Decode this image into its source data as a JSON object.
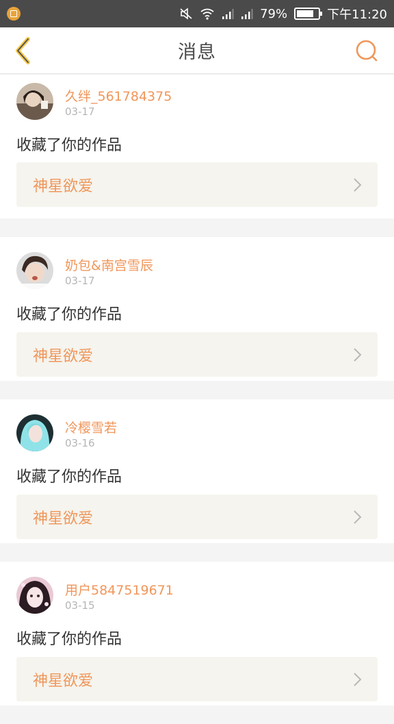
{
  "status_bar": {
    "battery": "79%",
    "time": "下午11:20",
    "battery_level": 0.79
  },
  "header": {
    "title": "消息",
    "accent_color": "#f0965a"
  },
  "messages": [
    {
      "user": "久绊_561784375",
      "date": "03-17",
      "action": "收藏了你的作品",
      "work": "神星欲爱"
    },
    {
      "user": "奶包&南宫雪辰",
      "date": "03-17",
      "action": "收藏了你的作品",
      "work": "神星欲爱"
    },
    {
      "user": "冷樱雪若",
      "date": "03-16",
      "action": "收藏了你的作品",
      "work": "神星欲爱"
    },
    {
      "user": "用户5847519671",
      "date": "03-15",
      "action": "收藏了你的作品",
      "work": "神星欲爱"
    }
  ]
}
